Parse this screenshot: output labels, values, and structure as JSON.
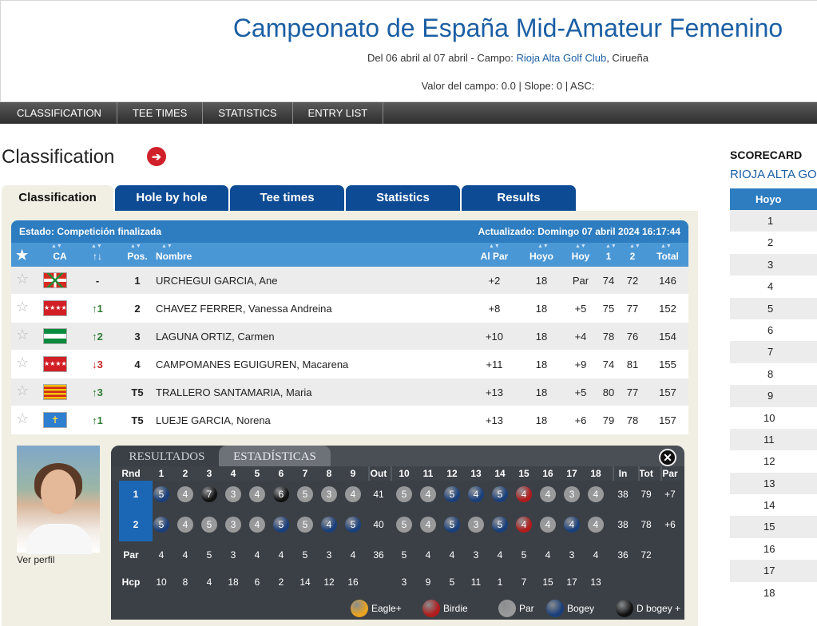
{
  "header": {
    "title": "Campeonato de España Mid-Amateur Femenino",
    "dates_prefix": "Del 06 abril al 07 abril - Campo: ",
    "venue": "Rioja Alta Golf Club",
    "dates_suffix": ", Cirueña",
    "course_value": "Valor del campo: 0.0 | Slope: 0 | ASC:"
  },
  "nav": [
    "CLASSIFICATION",
    "TEE TIMES",
    "STATISTICS",
    "ENTRY LIST"
  ],
  "page_title": "Classification",
  "tabs": [
    "Classification",
    "Hole by hole",
    "Tee times",
    "Statistics",
    "Results"
  ],
  "status": {
    "left": "Estado: Competición finalizada",
    "right": "Actualizado: Domingo 07 abril 2024 16:17:44"
  },
  "columns": {
    "ca": "CA",
    "move": "↑↓",
    "pos": "Pos.",
    "name": "Nombre",
    "topar": "Al Par",
    "hole": "Hoyo",
    "today": "Hoy",
    "r1": "1",
    "r2": "2",
    "total": "Total"
  },
  "rows": [
    {
      "flag": "ikurrina",
      "move": "-",
      "pos": "1",
      "name": "URCHEGUI GARCIA, Ane",
      "topar": "+2",
      "hole": "18",
      "today": "Par",
      "r1": "74",
      "r2": "72",
      "total": "146"
    },
    {
      "flag": "madrid",
      "move": "1",
      "dir": "up",
      "pos": "2",
      "name": "CHAVEZ FERRER, Vanessa Andreina",
      "topar": "+8",
      "hole": "18",
      "today": "+5",
      "r1": "75",
      "r2": "77",
      "total": "152"
    },
    {
      "flag": "andalucia",
      "move": "2",
      "dir": "up",
      "pos": "3",
      "name": "LAGUNA ORTIZ, Carmen",
      "topar": "+10",
      "hole": "18",
      "today": "+4",
      "r1": "78",
      "r2": "76",
      "total": "154"
    },
    {
      "flag": "madrid",
      "move": "3",
      "dir": "down",
      "pos": "4",
      "name": "CAMPOMANES EGUIGUREN, Macarena",
      "topar": "+11",
      "hole": "18",
      "today": "+9",
      "r1": "74",
      "r2": "81",
      "total": "155"
    },
    {
      "flag": "cataluna",
      "move": "3",
      "dir": "up",
      "pos": "T5",
      "name": "TRALLERO SANTAMARIA, Maria",
      "topar": "+13",
      "hole": "18",
      "today": "+5",
      "r1": "80",
      "r2": "77",
      "total": "157"
    },
    {
      "flag": "asturias",
      "move": "1",
      "dir": "up",
      "pos": "T5",
      "name": "LUEJE GARCIA, Norena",
      "topar": "+13",
      "hole": "18",
      "today": "+6",
      "r1": "79",
      "r2": "78",
      "total": "157"
    }
  ],
  "profile_link": "Ver perfil",
  "scorecard_tabs": [
    "RESULTADOS",
    "ESTADÍSTICAS"
  ],
  "score_header": [
    "Rnd",
    "1",
    "2",
    "3",
    "4",
    "5",
    "6",
    "7",
    "8",
    "9",
    "Out",
    "10",
    "11",
    "12",
    "13",
    "14",
    "15",
    "16",
    "17",
    "18",
    "In",
    "Tot",
    "Par"
  ],
  "rounds": [
    {
      "rnd": "1",
      "scores": [
        "5",
        "4",
        "7",
        "3",
        "4",
        "6",
        "5",
        "3",
        "4",
        "5",
        "4",
        "5",
        "4",
        "5",
        "4",
        "4",
        "3",
        "4"
      ],
      "out": "41",
      "in": "38",
      "tot": "79",
      "par": "+7"
    },
    {
      "rnd": "2",
      "scores": [
        "5",
        "4",
        "5",
        "3",
        "4",
        "5",
        "5",
        "4",
        "5",
        "5",
        "4",
        "5",
        "3",
        "5",
        "4",
        "4",
        "4",
        "4"
      ],
      "out": "40",
      "in": "38",
      "tot": "78",
      "par": "+6"
    }
  ],
  "par_row": {
    "label": "Par",
    "holes": [
      "4",
      "4",
      "5",
      "3",
      "4",
      "4",
      "5",
      "3",
      "4",
      "5",
      "4",
      "4",
      "3",
      "4",
      "5",
      "4",
      "3",
      "4"
    ],
    "out": "36",
    "in": "36",
    "tot": "72"
  },
  "hcp_row": {
    "label": "Hcp",
    "holes": [
      "10",
      "8",
      "4",
      "18",
      "6",
      "2",
      "14",
      "12",
      "16",
      "3",
      "9",
      "5",
      "11",
      "1",
      "7",
      "15",
      "17",
      "13"
    ]
  },
  "legend": [
    "Eagle+",
    "Birdie",
    "Par",
    "Bogey",
    "D bogey +"
  ],
  "colors": {
    "eagle": "#e8a321",
    "birdie": "#b01c1c",
    "par": "#9a9a9a",
    "bogey": "#1a3f7a",
    "dbogey": "#111111"
  },
  "right": {
    "title": "SCORECARD",
    "subtitle": "RIOJA ALTA GOLF",
    "col": "Hoyo",
    "holes": [
      "1",
      "2",
      "3",
      "4",
      "5",
      "6",
      "7",
      "8",
      "9",
      "10",
      "11",
      "12",
      "13",
      "14",
      "15",
      "16",
      "17",
      "18"
    ]
  }
}
